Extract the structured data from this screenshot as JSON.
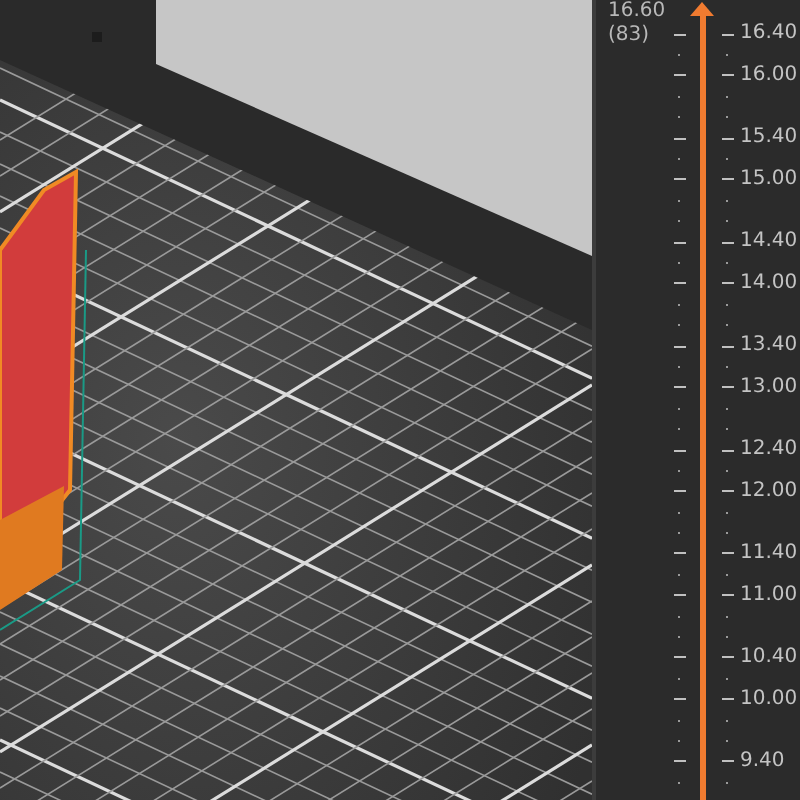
{
  "layer_slider": {
    "top_value": "16.60",
    "top_layer": "(83)",
    "level": 1,
    "ticks": [
      {
        "kind": "major",
        "label": "16.40"
      },
      {
        "kind": "minor"
      },
      {
        "kind": "major",
        "label": "16.00"
      },
      {
        "kind": "minor"
      },
      {
        "kind": "minor"
      },
      {
        "kind": "major",
        "label": "15.40"
      },
      {
        "kind": "minor"
      },
      {
        "kind": "major",
        "label": "15.00"
      },
      {
        "kind": "minor"
      },
      {
        "kind": "minor"
      },
      {
        "kind": "major",
        "label": "14.40"
      },
      {
        "kind": "minor"
      },
      {
        "kind": "major",
        "label": "14.00"
      },
      {
        "kind": "minor"
      },
      {
        "kind": "minor"
      },
      {
        "kind": "major",
        "label": "13.40"
      },
      {
        "kind": "minor"
      },
      {
        "kind": "major",
        "label": "13.00"
      },
      {
        "kind": "minor"
      },
      {
        "kind": "minor"
      },
      {
        "kind": "major",
        "label": "12.40"
      },
      {
        "kind": "minor"
      },
      {
        "kind": "major",
        "label": "12.00"
      },
      {
        "kind": "minor"
      },
      {
        "kind": "minor"
      },
      {
        "kind": "major",
        "label": "11.40"
      },
      {
        "kind": "minor"
      },
      {
        "kind": "major",
        "label": "11.00"
      },
      {
        "kind": "minor"
      },
      {
        "kind": "minor"
      },
      {
        "kind": "major",
        "label": "10.40"
      },
      {
        "kind": "minor"
      },
      {
        "kind": "major",
        "label": "10.00"
      },
      {
        "kind": "minor"
      },
      {
        "kind": "minor"
      },
      {
        "kind": "major",
        "label": "9.40"
      },
      {
        "kind": "minor"
      }
    ]
  }
}
